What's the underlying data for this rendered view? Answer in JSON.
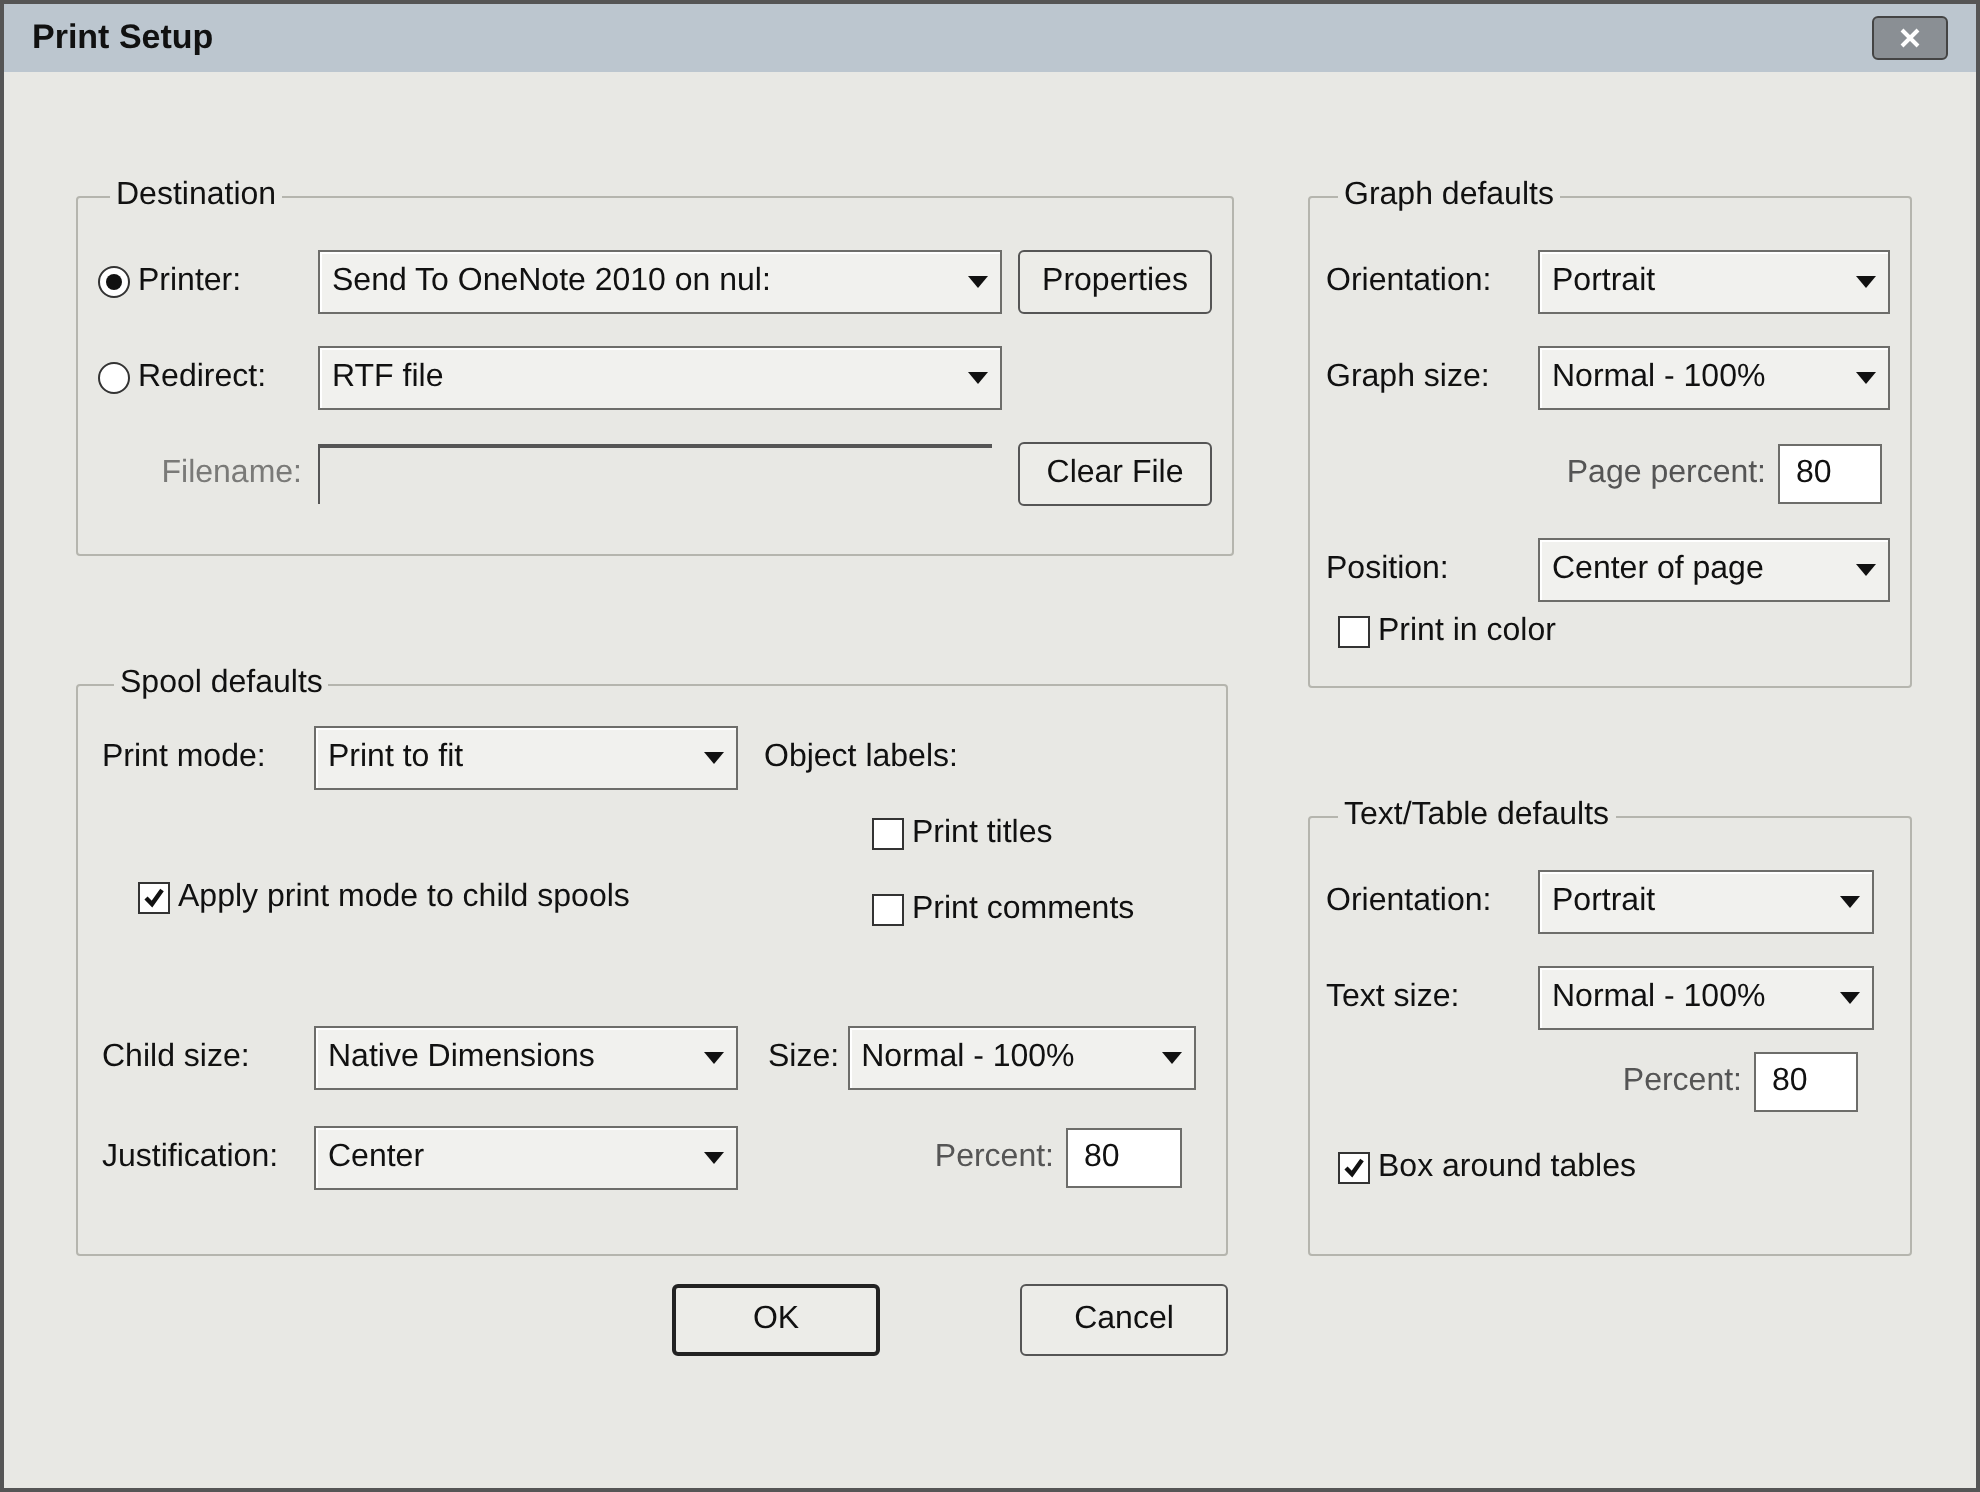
{
  "window": {
    "title": "Print Setup"
  },
  "destination": {
    "title": "Destination",
    "printer": {
      "label": "Printer:",
      "selected": true,
      "value": "Send To OneNote 2010 on nul:"
    },
    "properties_button": "Properties",
    "redirect": {
      "label": "Redirect:",
      "selected": false,
      "value": "RTF file"
    },
    "filename": {
      "label": "Filename:",
      "disabled": true
    },
    "clear_file_button": "Clear File"
  },
  "spool_defaults": {
    "title": "Spool defaults",
    "print_mode": {
      "label": "Print mode:",
      "value": "Print to fit"
    },
    "apply_to_child": {
      "label": "Apply print mode to child spools",
      "checked": true
    },
    "object_labels": {
      "label": "Object labels:",
      "options": [
        {
          "label": "Print titles",
          "checked": false
        },
        {
          "label": "Print comments",
          "checked": false
        }
      ]
    },
    "child_size": {
      "label": "Child size:",
      "value": "Native Dimensions"
    },
    "size": {
      "label": "Size:",
      "value": "Normal - 100%"
    },
    "justification": {
      "label": "Justification:",
      "value": "Center"
    },
    "percent": {
      "label": "Percent:",
      "value": "80"
    }
  },
  "graph_defaults": {
    "title": "Graph defaults",
    "orientation": {
      "label": "Orientation:",
      "value": "Portrait"
    },
    "graph_size": {
      "label": "Graph size:",
      "value": "Normal - 100%"
    },
    "page_percent": {
      "label": "Page percent:",
      "value": "80"
    },
    "position": {
      "label": "Position:",
      "value": "Center of page"
    },
    "print_in_color": {
      "label": "Print in color",
      "checked": false
    }
  },
  "text_table_defaults": {
    "title": "Text/Table defaults",
    "orientation": {
      "label": "Orientation:",
      "value": "Portrait"
    },
    "text_size": {
      "label": "Text size:",
      "value": "Normal - 100%"
    },
    "percent": {
      "label": "Percent:",
      "value": "80"
    },
    "box_around_tables": {
      "label": "Box around tables",
      "checked": true
    }
  },
  "buttons": [
    {
      "label": "OK",
      "default": true
    },
    {
      "label": "Cancel",
      "default": false
    }
  ]
}
